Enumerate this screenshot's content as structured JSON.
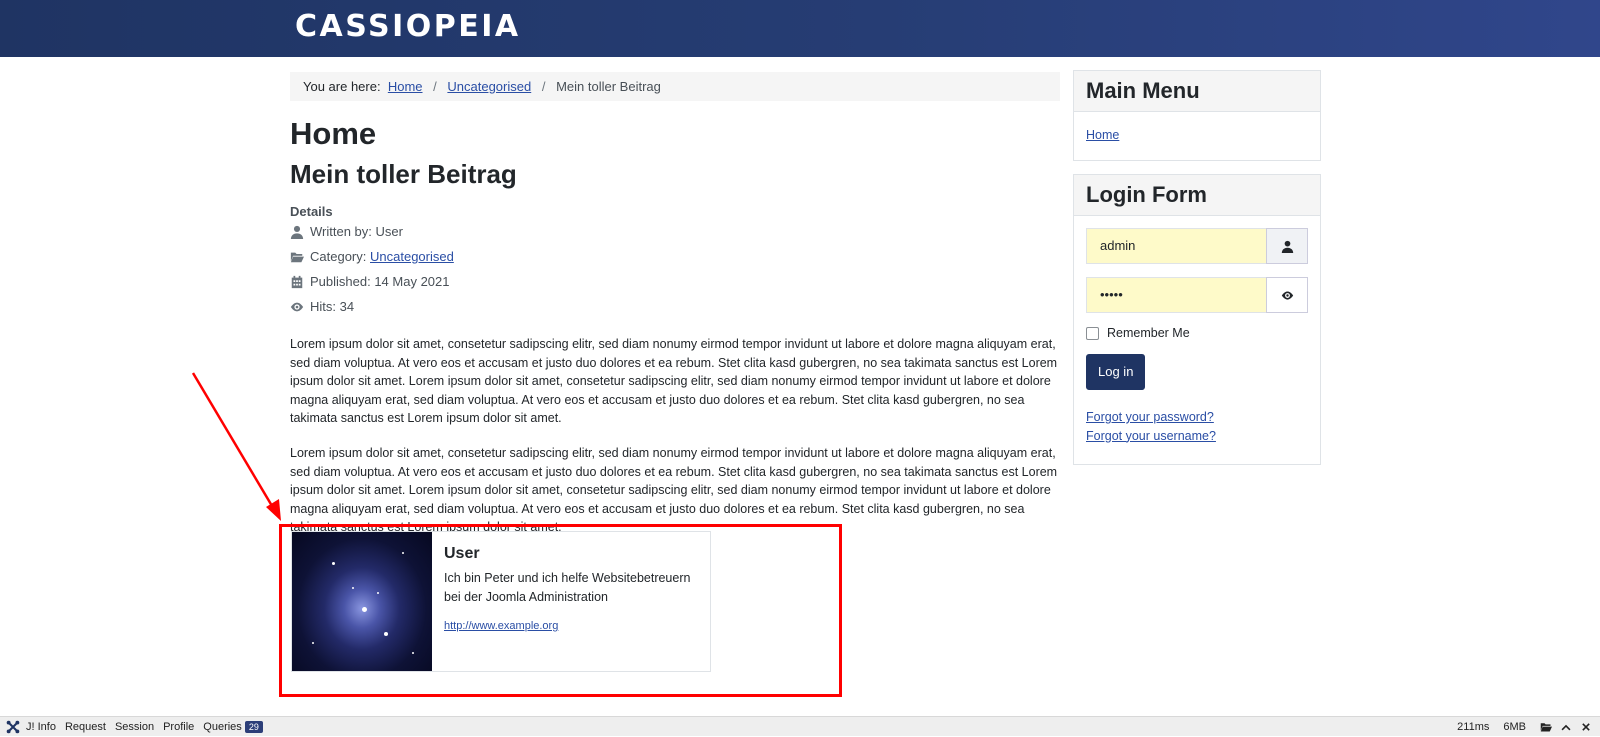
{
  "site": {
    "brand": "CASSIOPEIA"
  },
  "breadcrumb": {
    "prefix": "You are here:",
    "items": [
      "Home",
      "Uncategorised"
    ],
    "current": "Mein toller Beitrag",
    "separator": "/"
  },
  "page": {
    "title": "Home",
    "article_title": "Mein toller Beitrag",
    "details_label": "Details",
    "meta": {
      "author": "Written by: User",
      "category_prefix": "Category:",
      "category_link": "Uncategorised",
      "published": "Published: 14 May 2021",
      "hits": "Hits: 34"
    },
    "paragraphs": [
      "Lorem ipsum dolor sit amet, consetetur sadipscing elitr, sed diam nonumy eirmod tempor invidunt ut labore et dolore magna aliquyam erat, sed diam voluptua. At vero eos et accusam et justo duo dolores et ea rebum. Stet clita kasd gubergren, no sea takimata sanctus est Lorem ipsum dolor sit amet. Lorem ipsum dolor sit amet, consetetur sadipscing elitr, sed diam nonumy eirmod tempor invidunt ut labore et dolore magna aliquyam erat, sed diam voluptua. At vero eos et accusam et justo duo dolores et ea rebum. Stet clita kasd gubergren, no sea takimata sanctus est Lorem ipsum dolor sit amet.",
      "Lorem ipsum dolor sit amet, consetetur sadipscing elitr, sed diam nonumy eirmod tempor invidunt ut labore et dolore magna aliquyam erat, sed diam voluptua. At vero eos et accusam et justo duo dolores et ea rebum. Stet clita kasd gubergren, no sea takimata sanctus est Lorem ipsum dolor sit amet. Lorem ipsum dolor sit amet, consetetur sadipscing elitr, sed diam nonumy eirmod tempor invidunt ut labore et dolore magna aliquyam erat, sed diam voluptua. At vero eos et accusam et justo duo dolores et ea rebum. Stet clita kasd gubergren, no sea takimata sanctus est Lorem ipsum dolor sit amet."
    ]
  },
  "author_card": {
    "name": "User",
    "bio": "Ich bin Peter und ich helfe Websitebetreuern bei der Joomla Administration",
    "url": "http://www.example.org"
  },
  "annotation": {
    "color": "#ff0000"
  },
  "sidebar": {
    "main_menu": {
      "title": "Main Menu",
      "items": [
        "Home"
      ]
    },
    "login": {
      "title": "Login Form",
      "username_value": "admin",
      "password_value": "•••••",
      "remember_label": "Remember Me",
      "login_button": "Log in",
      "forgot_password": "Forgot your password?",
      "forgot_username": "Forgot your username?"
    }
  },
  "debugbar": {
    "items": [
      "J! Info",
      "Request",
      "Session",
      "Profile",
      "Queries"
    ],
    "queries_count": "29",
    "time": "211ms",
    "memory": "6MB"
  },
  "colors": {
    "header": "#1f3463",
    "accent": "#1f3463",
    "link": "#2a4ea5",
    "autofill": "#fefac9"
  }
}
